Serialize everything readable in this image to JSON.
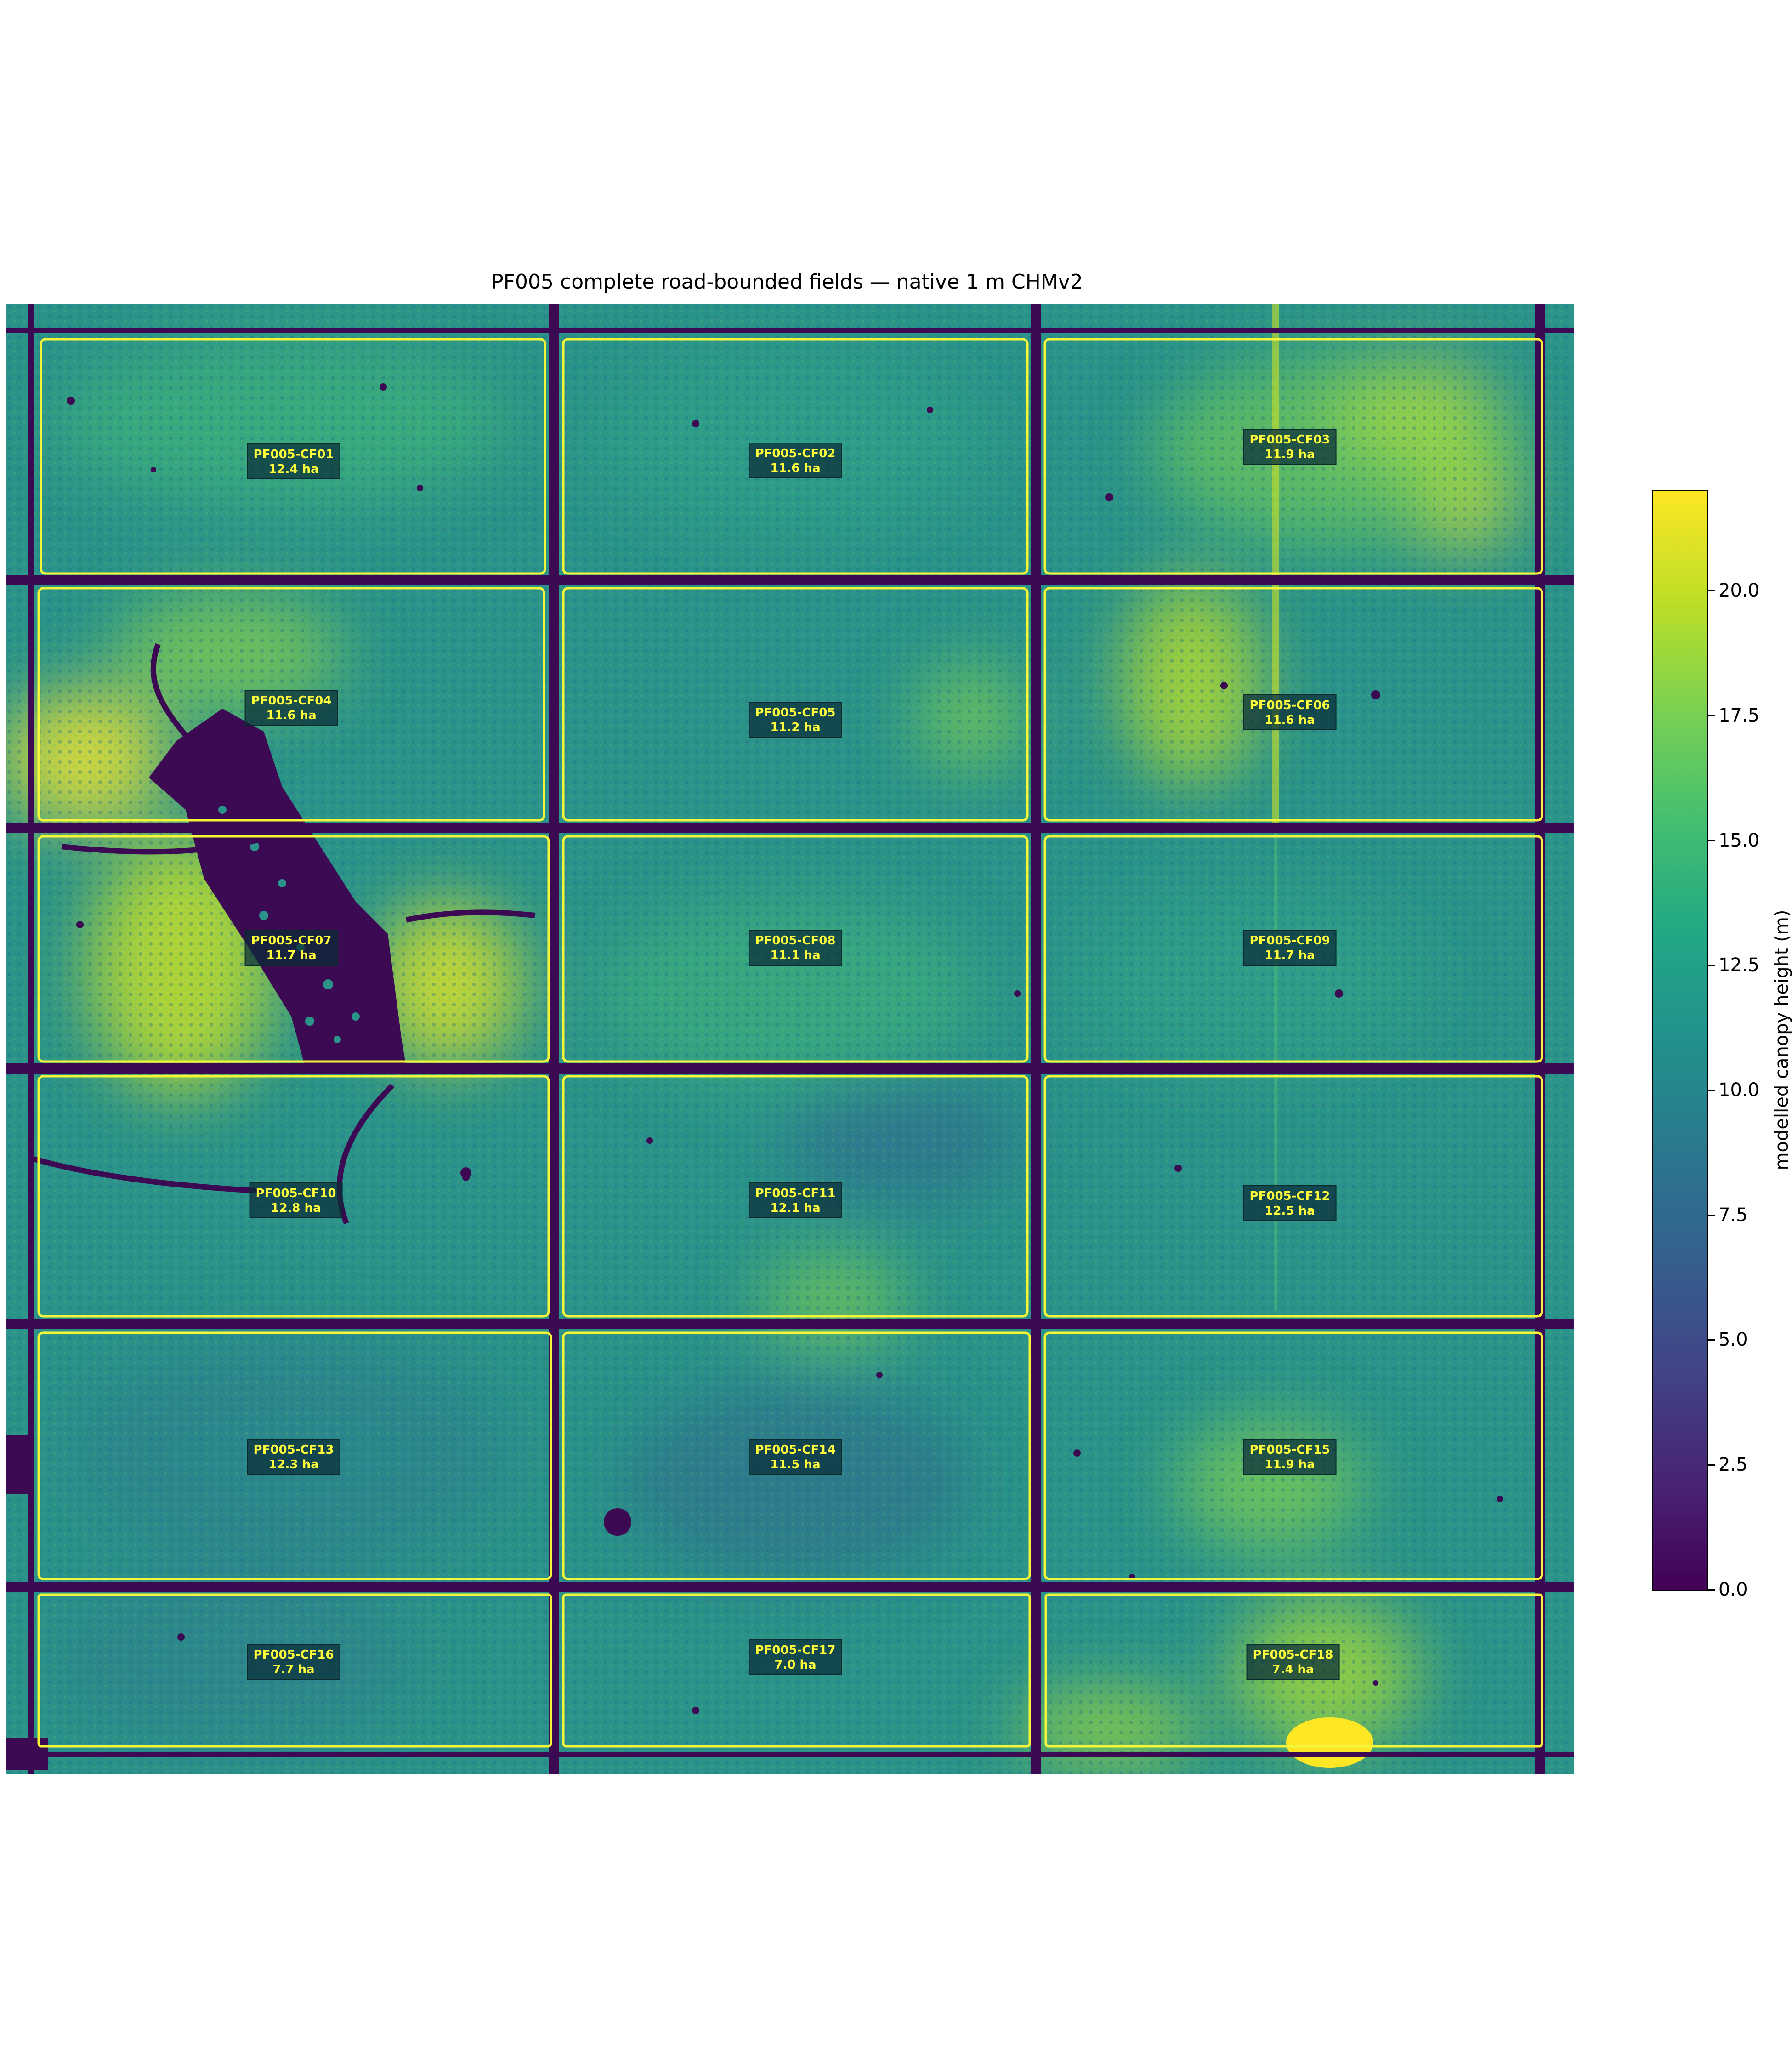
{
  "title": "PF005 complete road-bounded fields — native 1 m CHMv2",
  "colorbar": {
    "label": "modelled canopy height (m)",
    "ticks": [
      "0.0",
      "2.5",
      "5.0",
      "7.5",
      "10.0",
      "12.5",
      "15.0",
      "17.5",
      "20.0"
    ],
    "range": [
      0,
      22
    ],
    "colormap": "viridis",
    "colors": [
      "#440154",
      "#482475",
      "#414487",
      "#355f8d",
      "#2a788e",
      "#21918c",
      "#22a884",
      "#44bf70",
      "#7ad151",
      "#bddf26",
      "#fde725"
    ]
  },
  "boundary_color": "#f5f53b",
  "road_color": "#3b0a52",
  "fields": [
    {
      "id": "PF005-CF01",
      "area": "12.4 ha"
    },
    {
      "id": "PF005-CF02",
      "area": "11.6 ha"
    },
    {
      "id": "PF005-CF03",
      "area": "11.9 ha"
    },
    {
      "id": "PF005-CF04",
      "area": "11.6 ha"
    },
    {
      "id": "PF005-CF05",
      "area": "11.2 ha"
    },
    {
      "id": "PF005-CF06",
      "area": "11.6 ha"
    },
    {
      "id": "PF005-CF07",
      "area": "11.7 ha"
    },
    {
      "id": "PF005-CF08",
      "area": "11.1 ha"
    },
    {
      "id": "PF005-CF09",
      "area": "11.7 ha"
    },
    {
      "id": "PF005-CF10",
      "area": "12.8 ha"
    },
    {
      "id": "PF005-CF11",
      "area": "12.1 ha"
    },
    {
      "id": "PF005-CF12",
      "area": "12.5 ha"
    },
    {
      "id": "PF005-CF13",
      "area": "12.3 ha"
    },
    {
      "id": "PF005-CF14",
      "area": "11.5 ha"
    },
    {
      "id": "PF005-CF15",
      "area": "11.9 ha"
    },
    {
      "id": "PF005-CF16",
      "area": "7.7 ha"
    },
    {
      "id": "PF005-CF17",
      "area": "7.0 ha"
    },
    {
      "id": "PF005-CF18",
      "area": "7.4 ha"
    }
  ]
}
